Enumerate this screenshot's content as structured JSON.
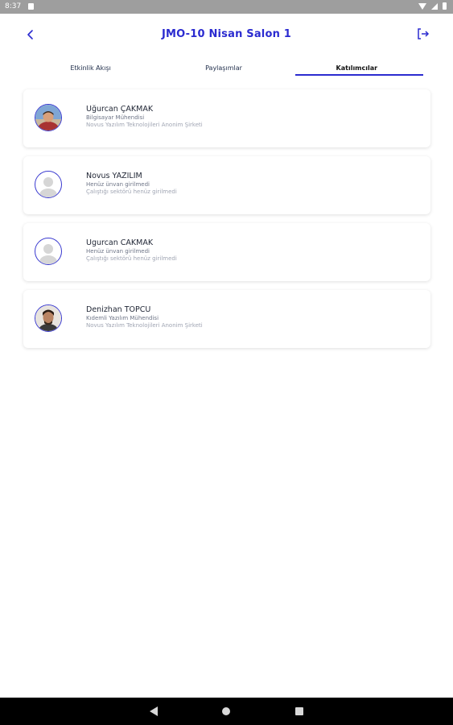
{
  "status_bar": {
    "time": "8:37"
  },
  "header": {
    "title": "JMO-10 Nisan Salon 1"
  },
  "tabs": [
    {
      "label": "Etkinlik Akışı"
    },
    {
      "label": "Paylaşımlar"
    },
    {
      "label": "Katılımcılar"
    }
  ],
  "participants": [
    {
      "name": "Uğurcan ÇAKMAK",
      "role": "Bilgisayar Mühendisi",
      "company": "Novus Yazılım Teknolojileri Anonim Şirketi",
      "avatar": "photo"
    },
    {
      "name": "Novus YAZILIM",
      "role": "Henüz ünvan girilmedi",
      "company": "Çalıştığı sektörü henüz girilmedi",
      "avatar": "default"
    },
    {
      "name": "Ugurcan CAKMAK",
      "role": "Henüz ünvan girilmedi",
      "company": "Çalıştığı sektörü henüz girilmedi",
      "avatar": "default"
    },
    {
      "name": "Denizhan TOPCU",
      "role": "Kıdemli Yazılım Mühendisi",
      "company": "Novus Yazılım Teknolojileri Anonim Şirketi",
      "avatar": "photo"
    }
  ],
  "colors": {
    "accent": "#2b2bd0"
  }
}
